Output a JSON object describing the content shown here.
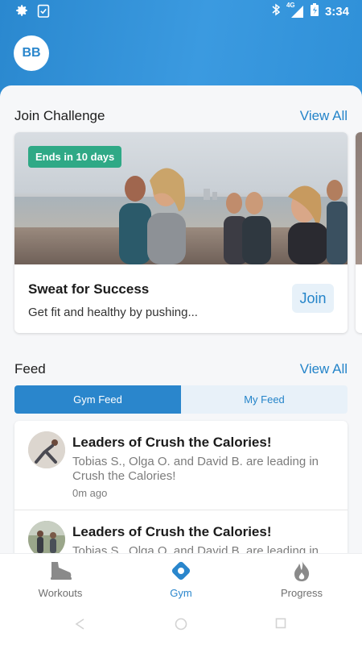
{
  "status_bar": {
    "time": "3:34",
    "network": "4G"
  },
  "profile": {
    "initials": "BB"
  },
  "challenge_section": {
    "title": "Join Challenge",
    "view_all": "View All",
    "card": {
      "badge": "Ends in 10 days",
      "title": "Sweat for Success",
      "description": "Get fit and healthy by pushing...",
      "join_label": "Join"
    }
  },
  "feed_section": {
    "title": "Feed",
    "view_all": "View All",
    "tabs": [
      {
        "label": "Gym Feed",
        "active": true
      },
      {
        "label": "My Feed",
        "active": false
      }
    ],
    "items": [
      {
        "title": "Leaders of Crush the Calories!",
        "text": "Tobias S., Olga O. and David B. are leading in Crush the Calories!",
        "time": "0m ago"
      },
      {
        "title": "Leaders of Crush the Calories!",
        "text": "Tobias S., Olga O. and David B. are leading in Crush the Calories!",
        "time": ""
      }
    ]
  },
  "bottom_nav": {
    "items": [
      {
        "label": "Workouts",
        "icon": "shoe-icon",
        "active": false
      },
      {
        "label": "Gym",
        "icon": "location-pin-icon",
        "active": true
      },
      {
        "label": "Progress",
        "icon": "flame-icon",
        "active": false
      }
    ]
  },
  "colors": {
    "primary": "#2a86cc",
    "badge": "#2fa986",
    "link": "#2484c9"
  }
}
